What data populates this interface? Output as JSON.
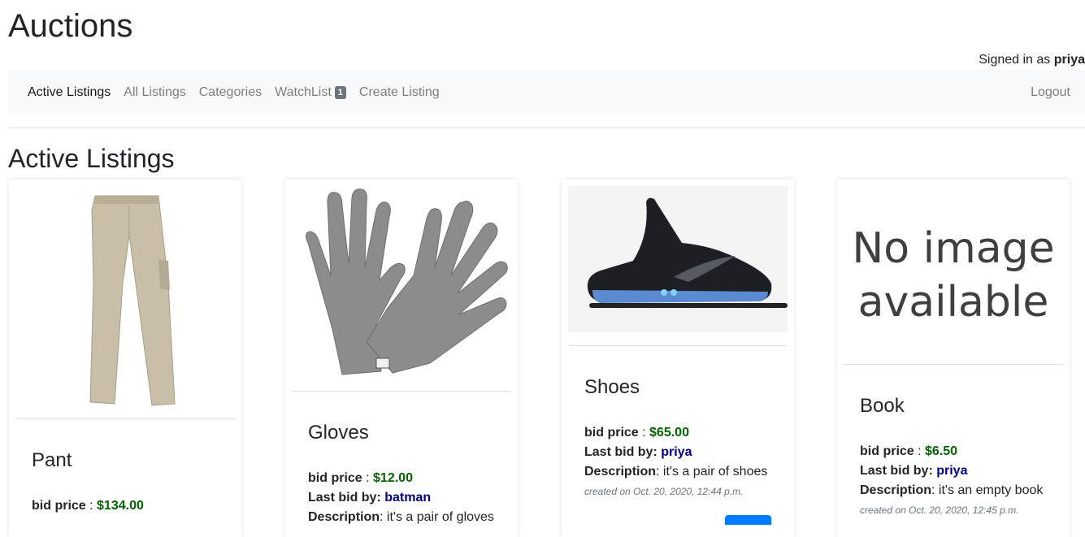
{
  "header": {
    "site_title": "Auctions",
    "signed_in_prefix": "Signed in as",
    "username": "priya"
  },
  "nav": {
    "items": [
      {
        "label": "Active Listings",
        "active": true
      },
      {
        "label": "All Listings"
      },
      {
        "label": "Categories"
      },
      {
        "label": "WatchList",
        "badge": "1"
      },
      {
        "label": "Create Listing"
      }
    ],
    "logout_label": "Logout"
  },
  "main": {
    "heading": "Active Listings",
    "labels": {
      "bid_price": "bid price",
      "price_sep": " : ",
      "last_bid": "Last bid by:",
      "description": "Description",
      "desc_sep": ": "
    },
    "listings": [
      {
        "title": "Pant",
        "image_icon": "pants-image",
        "bid_price": "$134.00"
      },
      {
        "title": "Gloves",
        "image_icon": "gloves-image",
        "bid_price": "$12.00",
        "last_bidder": "batman",
        "description": "it's a pair of gloves"
      },
      {
        "title": "Shoes",
        "image_icon": "shoe-image",
        "bid_price": "$65.00",
        "last_bidder": "priya",
        "description": "it's a pair of shoes",
        "created": "created on Oct. 20, 2020, 12:44 p.m."
      },
      {
        "title": "Book",
        "image_icon": "no-image-placeholder",
        "image_text_line1": "No image",
        "image_text_line2": "available",
        "bid_price": "$6.50",
        "last_bidder": "priya",
        "description": "it's an empty book",
        "created": "created on Oct. 20, 2020, 12:45 p.m."
      }
    ]
  },
  "colors": {
    "price": "#006400",
    "bidder": "#000080",
    "navbar_bg": "#f8f9fa",
    "badge_bg": "#6c757d",
    "button": "#007bff"
  }
}
